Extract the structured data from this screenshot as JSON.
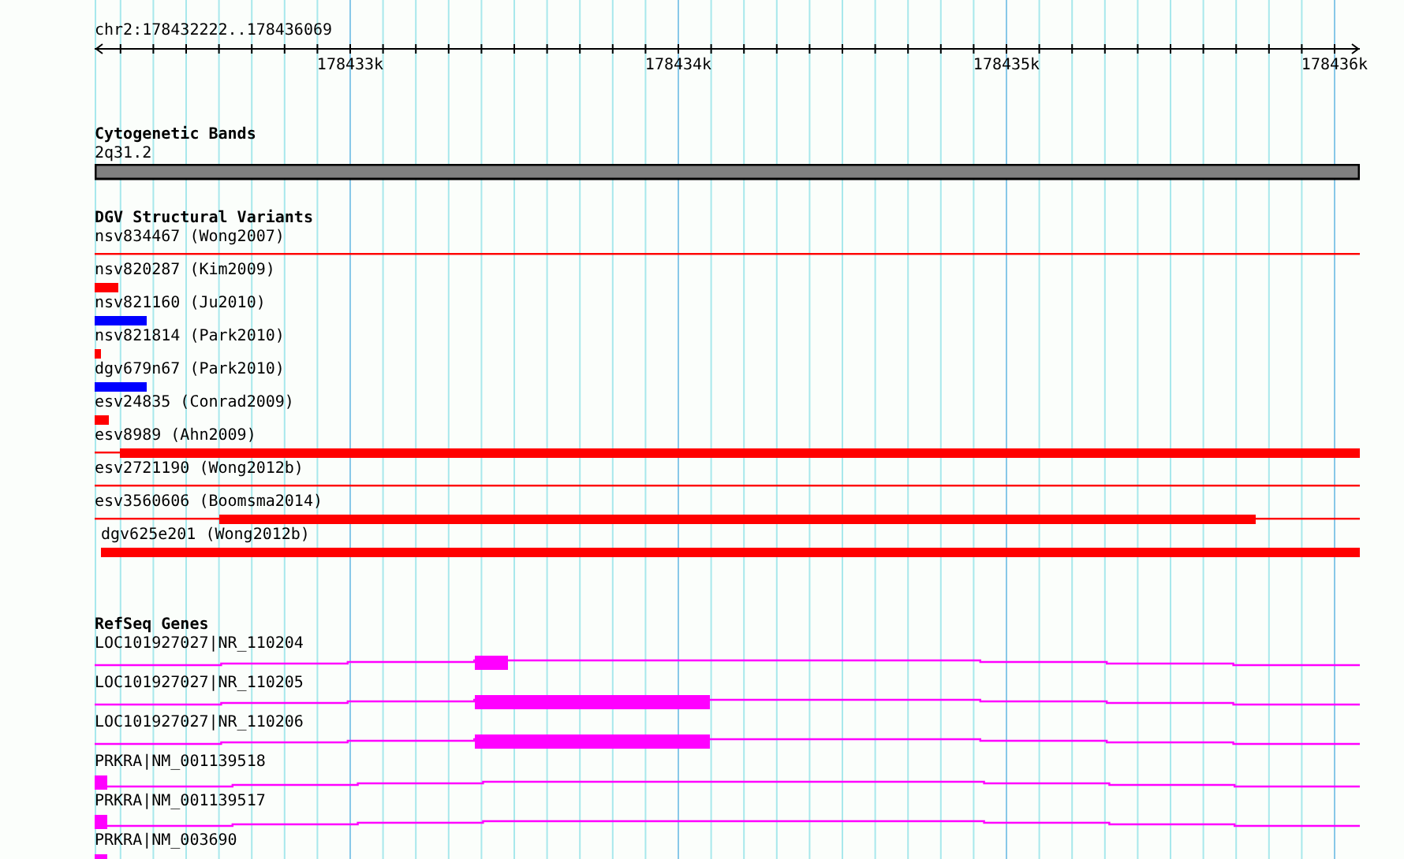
{
  "ruler": {
    "location": "chr2:178432222..178436069",
    "ticks": [
      "178433k",
      "178434k",
      "178435k",
      "178436k"
    ]
  },
  "tracks": [
    {
      "kind": "bands",
      "title": "Cytogenetic Bands",
      "features": [
        {
          "label": "2q31.2"
        }
      ]
    },
    {
      "kind": "variants",
      "title": "DGV Structural Variants",
      "features": [
        {
          "label": "nsv834467 (Wong2007)",
          "color": "#ff0000"
        },
        {
          "label": "nsv820287 (Kim2009)",
          "color": "#ff0000"
        },
        {
          "label": "nsv821160 (Ju2010)",
          "color": "#0000ff"
        },
        {
          "label": "nsv821814 (Park2010)",
          "color": "#ff0000"
        },
        {
          "label": "dgv679n67 (Park2010)",
          "color": "#0000ff"
        },
        {
          "label": "esv24835 (Conrad2009)",
          "color": "#ff0000"
        },
        {
          "label": "esv8989 (Ahn2009)",
          "color": "#ff0000"
        },
        {
          "label": "esv2721190 (Wong2012b)",
          "color": "#ff0000"
        },
        {
          "label": "esv3560606 (Boomsma2014)",
          "color": "#ff0000"
        },
        {
          "label": "dgv625e201 (Wong2012b)",
          "color": "#ff0000"
        }
      ]
    },
    {
      "kind": "genes",
      "title": "RefSeq Genes",
      "features": [
        {
          "label": "LOC101927027|NR_110204"
        },
        {
          "label": "LOC101927027|NR_110205"
        },
        {
          "label": "LOC101927027|NR_110206"
        },
        {
          "label": "PRKRA|NM_001139518"
        },
        {
          "label": "PRKRA|NM_001139517"
        },
        {
          "label": "PRKRA|NM_003690"
        }
      ]
    }
  ]
}
